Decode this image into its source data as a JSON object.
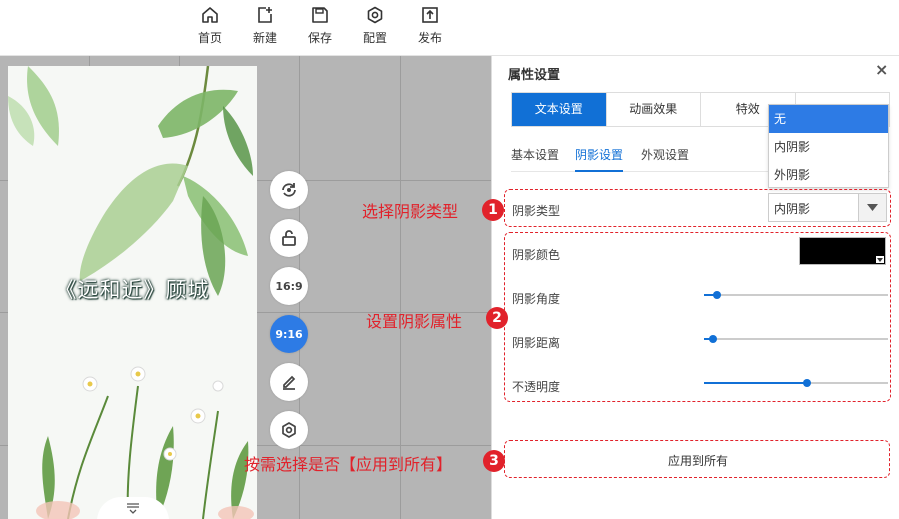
{
  "toolbar": {
    "items": [
      {
        "label": "首页",
        "icon": "home-icon"
      },
      {
        "label": "新建",
        "icon": "new-file-icon"
      },
      {
        "label": "保存",
        "icon": "save-icon"
      },
      {
        "label": "配置",
        "icon": "settings-icon"
      },
      {
        "label": "发布",
        "icon": "publish-icon"
      }
    ]
  },
  "canvas": {
    "poster_title": "《远和近》顾城",
    "side_buttons": [
      {
        "icon": "rotate-icon"
      },
      {
        "icon": "unlock-icon"
      },
      {
        "label": "16:9"
      },
      {
        "label": "9:16",
        "active": true
      },
      {
        "icon": "edit-icon"
      },
      {
        "icon": "gear-icon"
      }
    ]
  },
  "annotations": {
    "step1": {
      "text": "选择阴影类型",
      "num": "1"
    },
    "step2": {
      "text": "设置阴影属性",
      "num": "2"
    },
    "step3": {
      "text": "按需选择是否【应用到所有】",
      "num": "3"
    },
    "color": "#e1222b"
  },
  "panel": {
    "title": "属性设置",
    "close": "×",
    "tabs": [
      "文本设置",
      "动画效果",
      "特效",
      ""
    ],
    "active_tab": 0,
    "subtabs": [
      "基本设置",
      "阴影设置",
      "外观设置"
    ],
    "active_subtab": 1,
    "shadow_type": {
      "label": "阴影类型",
      "value": "内阴影",
      "options": [
        "无",
        "内阴影",
        "外阴影"
      ],
      "highlighted_option": 0
    },
    "shadow_color": {
      "label": "阴影颜色",
      "value": "#000000"
    },
    "shadow_angle": {
      "label": "阴影角度",
      "level": 0.07
    },
    "shadow_distance": {
      "label": "阴影距离",
      "level": 0.05
    },
    "opacity": {
      "label": "不透明度",
      "level": 0.56
    },
    "apply_all": "应用到所有",
    "accent_color": "#1170d6"
  }
}
